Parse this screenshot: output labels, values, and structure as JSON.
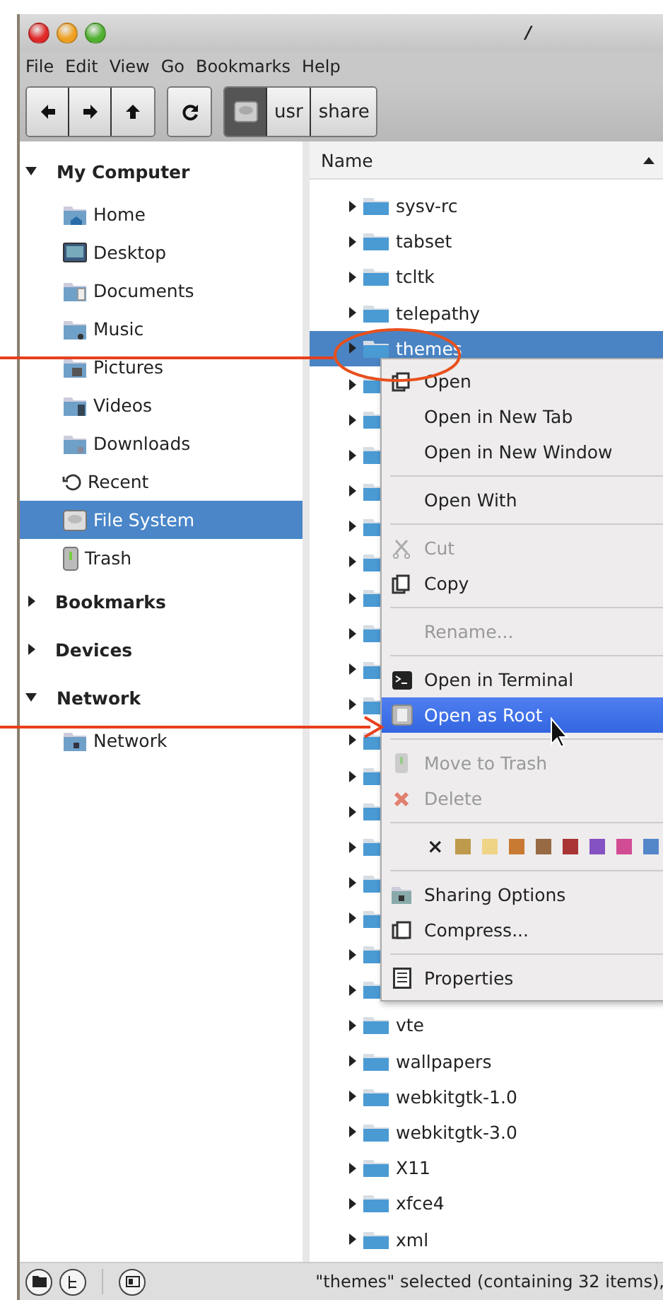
{
  "window": {
    "title": "/"
  },
  "menu_bar": [
    "File",
    "Edit",
    "View",
    "Go",
    "Bookmarks",
    "Help"
  ],
  "path_bar": [
    {
      "kind": "drive",
      "selected": true
    },
    {
      "kind": "folder",
      "label": "usr",
      "selected": false
    },
    {
      "kind": "folder",
      "label": "share",
      "selected": false
    }
  ],
  "sidebar": [
    {
      "title": "My Computer",
      "expanded": true,
      "items": [
        {
          "label": "Home",
          "selected": false
        },
        {
          "label": "Desktop",
          "selected": false
        },
        {
          "label": "Documents",
          "selected": false
        },
        {
          "label": "Music",
          "selected": false
        },
        {
          "label": "Pictures",
          "selected": false
        },
        {
          "label": "Videos",
          "selected": false
        },
        {
          "label": "Downloads",
          "selected": false
        },
        {
          "label": "Recent",
          "selected": false
        },
        {
          "label": "File System",
          "selected": true
        },
        {
          "label": "Trash",
          "selected": false
        }
      ]
    },
    {
      "title": "Bookmarks",
      "expanded": false
    },
    {
      "title": "Devices",
      "expanded": false
    },
    {
      "title": "Network",
      "expanded": true,
      "items": [
        {
          "label": "Network",
          "selected": false
        }
      ]
    }
  ],
  "file_list": {
    "columns": [
      "Name"
    ],
    "rows": [
      {
        "name": "sysv-rc",
        "selected": false
      },
      {
        "name": "tabset",
        "selected": false
      },
      {
        "name": "tcltk",
        "selected": false
      },
      {
        "name": "telepathy",
        "selected": false
      },
      {
        "name": "themes",
        "selected": true
      },
      {
        "selected": false
      },
      {
        "selected": false
      },
      {
        "selected": false
      },
      {
        "selected": false
      },
      {
        "selected": false
      },
      {
        "selected": false
      },
      {
        "selected": false
      },
      {
        "selected": false
      },
      {
        "selected": false
      },
      {
        "selected": false
      },
      {
        "selected": false
      },
      {
        "selected": false
      },
      {
        "selected": false
      },
      {
        "selected": false
      },
      {
        "selected": false
      },
      {
        "selected": false
      },
      {
        "selected": false
      },
      {
        "selected": false
      },
      {
        "name": "vte",
        "selected": false
      },
      {
        "name": "wallpapers",
        "selected": false
      },
      {
        "name": "webkitgtk-1.0",
        "selected": false
      },
      {
        "name": "webkitgtk-3.0",
        "selected": false
      },
      {
        "name": "X11",
        "selected": false
      },
      {
        "name": "xfce4",
        "selected": false
      },
      {
        "name": "xml",
        "selected": false
      }
    ]
  },
  "context_menu": [
    {
      "kind": "item",
      "label": "Open",
      "disabled": false,
      "selected": false
    },
    {
      "kind": "item",
      "label": "Open in New Tab",
      "disabled": false,
      "selected": false
    },
    {
      "kind": "item",
      "label": "Open in New Window",
      "disabled": false,
      "selected": false
    },
    {
      "kind": "separator"
    },
    {
      "kind": "item",
      "label": "Open With",
      "disabled": false,
      "selected": false
    },
    {
      "kind": "separator"
    },
    {
      "kind": "item",
      "label": "Cut",
      "disabled": true,
      "selected": false
    },
    {
      "kind": "item",
      "label": "Copy",
      "disabled": false,
      "selected": false
    },
    {
      "kind": "separator"
    },
    {
      "kind": "item",
      "label": "Rename...",
      "disabled": true,
      "selected": false
    },
    {
      "kind": "separator"
    },
    {
      "kind": "item",
      "label": "Open in Terminal",
      "disabled": false,
      "selected": false
    },
    {
      "kind": "item",
      "label": "Open as Root",
      "disabled": false,
      "selected": true
    },
    {
      "kind": "separator"
    },
    {
      "kind": "item",
      "label": "Move to Trash",
      "disabled": true,
      "selected": false
    },
    {
      "kind": "item",
      "label": "Delete",
      "disabled": true,
      "selected": false
    },
    {
      "kind": "separator"
    },
    {
      "kind": "colors",
      "clear": "×",
      "colors": [
        {
          "color": "#be9a4c"
        },
        {
          "color": "#f0d486"
        },
        {
          "color": "#c97a32"
        },
        {
          "color": "#986a44"
        },
        {
          "color": "#a83434"
        },
        {
          "color": "#8452c2"
        },
        {
          "color": "#d24c94"
        },
        {
          "color": "#5486ca"
        }
      ]
    },
    {
      "kind": "separator"
    },
    {
      "kind": "item",
      "label": "Sharing Options",
      "disabled": false,
      "selected": false
    },
    {
      "kind": "item",
      "label": "Compress...",
      "disabled": false,
      "selected": false
    },
    {
      "kind": "separator"
    },
    {
      "kind": "item",
      "label": "Properties",
      "disabled": false,
      "selected": false
    }
  ],
  "status_bar": {
    "text": "\"themes\" selected (containing 32 items),"
  }
}
